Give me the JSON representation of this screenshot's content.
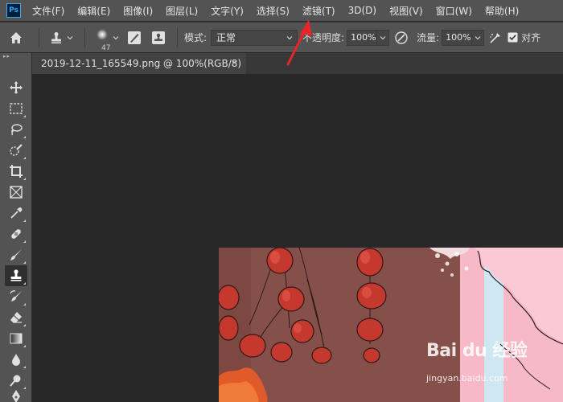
{
  "app": {
    "logo_text": "Ps"
  },
  "menu": {
    "items": [
      {
        "label": "文件(F)"
      },
      {
        "label": "编辑(E)"
      },
      {
        "label": "图像(I)"
      },
      {
        "label": "图层(L)"
      },
      {
        "label": "文字(Y)"
      },
      {
        "label": "选择(S)"
      },
      {
        "label": "滤镜(T)"
      },
      {
        "label": "3D(D)"
      },
      {
        "label": "视图(V)"
      },
      {
        "label": "窗口(W)"
      },
      {
        "label": "帮助(H)"
      }
    ]
  },
  "options": {
    "brush_size": "47",
    "mode_label": "模式:",
    "mode_value": "正常",
    "opacity_label": "不透明度:",
    "opacity_value": "100%",
    "flow_label": "流量:",
    "flow_value": "100%",
    "align_label": "对齐"
  },
  "document": {
    "tab_title": "2019-12-11_165549.png @ 100%(RGB/8)",
    "close_glyph": "×"
  },
  "watermark": {
    "brand": "Bai du 经验",
    "sub": "jingyan.baidu.com"
  },
  "tools": [
    {
      "name": "move-tool-icon"
    },
    {
      "name": "marquee-tool-icon"
    },
    {
      "name": "lasso-tool-icon"
    },
    {
      "name": "quick-selection-tool-icon"
    },
    {
      "name": "crop-tool-icon"
    },
    {
      "name": "frame-tool-icon"
    },
    {
      "name": "eyedropper-tool-icon"
    },
    {
      "name": "healing-brush-tool-icon"
    },
    {
      "name": "brush-tool-icon"
    },
    {
      "name": "clone-stamp-tool-icon"
    },
    {
      "name": "history-brush-tool-icon"
    },
    {
      "name": "eraser-tool-icon"
    },
    {
      "name": "gradient-tool-icon"
    },
    {
      "name": "blur-tool-icon"
    },
    {
      "name": "dodge-tool-icon"
    },
    {
      "name": "pen-tool-icon"
    }
  ],
  "colors": {
    "menubar_bg": "#535353",
    "canvas_bg": "#282828",
    "annotation_arrow": "#e8262a",
    "lantern_red": "#c4382e",
    "artwork_bg": "#86504a",
    "blossom_pink": "#f7b8c8"
  }
}
